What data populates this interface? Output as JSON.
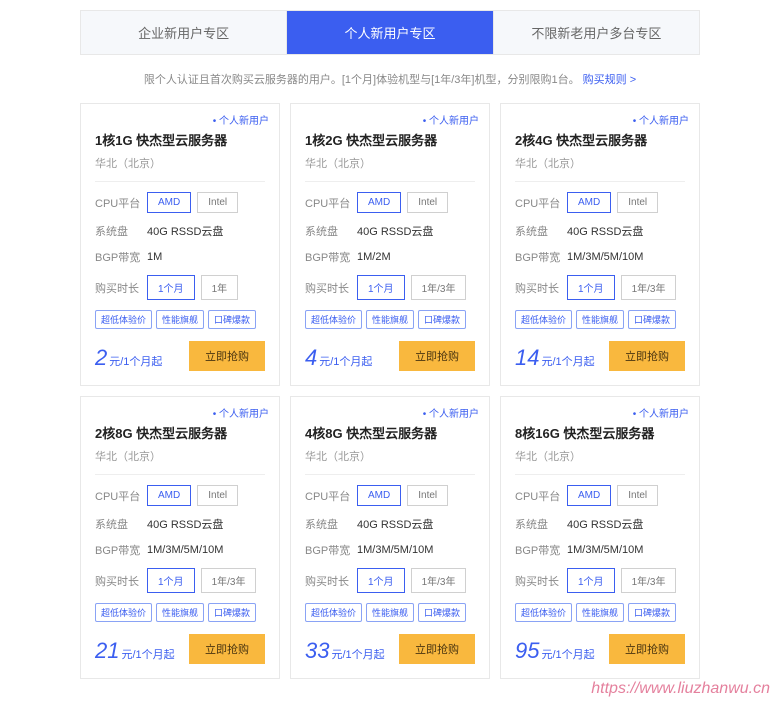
{
  "tabs": [
    {
      "label": "企业新用户专区",
      "active": false
    },
    {
      "label": "个人新用户专区",
      "active": true
    },
    {
      "label": "不限新老用户多台专区",
      "active": false
    }
  ],
  "description": "限个人认证且首次购买云服务器的用户。[1个月]体验机型与[1年/3年]机型，分别限购1台。",
  "rules_link": "购买规则 >",
  "cards": [
    {
      "badge": "个人新用户",
      "title": "1核1G 快杰型云服务器",
      "region": "华北（北京）",
      "specs": {
        "cpu_label": "CPU平台",
        "cpu_options": [
          "AMD",
          "Intel"
        ],
        "cpu_selected": "AMD",
        "disk_label": "系统盘",
        "disk_value": "40G RSSD云盘",
        "bgp_label": "BGP带宽",
        "bgp_value": "1M",
        "duration_label": "购买时长",
        "duration_options": [
          "1个月",
          "1年"
        ],
        "duration_selected": "1个月"
      },
      "tags": [
        "超低体验价",
        "性能旗舰",
        "口碑爆款"
      ],
      "price": "2",
      "price_unit": "元/1个月起",
      "buy": "立即抢购"
    },
    {
      "badge": "个人新用户",
      "title": "1核2G 快杰型云服务器",
      "region": "华北（北京）",
      "specs": {
        "cpu_label": "CPU平台",
        "cpu_options": [
          "AMD",
          "Intel"
        ],
        "cpu_selected": "AMD",
        "disk_label": "系统盘",
        "disk_value": "40G RSSD云盘",
        "bgp_label": "BGP带宽",
        "bgp_value": "1M/2M",
        "duration_label": "购买时长",
        "duration_options": [
          "1个月",
          "1年/3年"
        ],
        "duration_selected": "1个月"
      },
      "tags": [
        "超低体验价",
        "性能旗舰",
        "口碑爆款"
      ],
      "price": "4",
      "price_unit": "元/1个月起",
      "buy": "立即抢购"
    },
    {
      "badge": "个人新用户",
      "title": "2核4G 快杰型云服务器",
      "region": "华北（北京）",
      "specs": {
        "cpu_label": "CPU平台",
        "cpu_options": [
          "AMD",
          "Intel"
        ],
        "cpu_selected": "AMD",
        "disk_label": "系统盘",
        "disk_value": "40G RSSD云盘",
        "bgp_label": "BGP带宽",
        "bgp_value": "1M/3M/5M/10M",
        "duration_label": "购买时长",
        "duration_options": [
          "1个月",
          "1年/3年"
        ],
        "duration_selected": "1个月"
      },
      "tags": [
        "超低体验价",
        "性能旗舰",
        "口碑爆款"
      ],
      "price": "14",
      "price_unit": "元/1个月起",
      "buy": "立即抢购"
    },
    {
      "badge": "个人新用户",
      "title": "2核8G 快杰型云服务器",
      "region": "华北（北京）",
      "specs": {
        "cpu_label": "CPU平台",
        "cpu_options": [
          "AMD",
          "Intel"
        ],
        "cpu_selected": "AMD",
        "disk_label": "系统盘",
        "disk_value": "40G RSSD云盘",
        "bgp_label": "BGP带宽",
        "bgp_value": "1M/3M/5M/10M",
        "duration_label": "购买时长",
        "duration_options": [
          "1个月",
          "1年/3年"
        ],
        "duration_selected": "1个月"
      },
      "tags": [
        "超低体验价",
        "性能旗舰",
        "口碑爆款"
      ],
      "price": "21",
      "price_unit": "元/1个月起",
      "buy": "立即抢购"
    },
    {
      "badge": "个人新用户",
      "title": "4核8G 快杰型云服务器",
      "region": "华北（北京）",
      "specs": {
        "cpu_label": "CPU平台",
        "cpu_options": [
          "AMD",
          "Intel"
        ],
        "cpu_selected": "AMD",
        "disk_label": "系统盘",
        "disk_value": "40G RSSD云盘",
        "bgp_label": "BGP带宽",
        "bgp_value": "1M/3M/5M/10M",
        "duration_label": "购买时长",
        "duration_options": [
          "1个月",
          "1年/3年"
        ],
        "duration_selected": "1个月"
      },
      "tags": [
        "超低体验价",
        "性能旗舰",
        "口碑爆款"
      ],
      "price": "33",
      "price_unit": "元/1个月起",
      "buy": "立即抢购"
    },
    {
      "badge": "个人新用户",
      "title": "8核16G 快杰型云服务器",
      "region": "华北（北京）",
      "specs": {
        "cpu_label": "CPU平台",
        "cpu_options": [
          "AMD",
          "Intel"
        ],
        "cpu_selected": "AMD",
        "disk_label": "系统盘",
        "disk_value": "40G RSSD云盘",
        "bgp_label": "BGP带宽",
        "bgp_value": "1M/3M/5M/10M",
        "duration_label": "购买时长",
        "duration_options": [
          "1个月",
          "1年/3年"
        ],
        "duration_selected": "1个月"
      },
      "tags": [
        "超低体验价",
        "性能旗舰",
        "口碑爆款"
      ],
      "price": "95",
      "price_unit": "元/1个月起",
      "buy": "立即抢购"
    }
  ],
  "watermark": "https://www.liuzhanwu.cn"
}
